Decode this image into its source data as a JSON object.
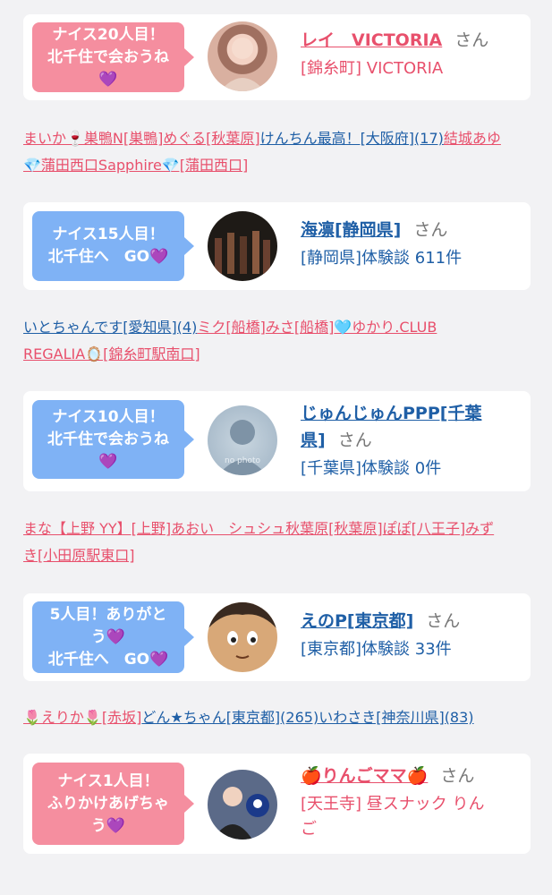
{
  "cards": [
    {
      "bubble": [
        "ナイス20人目！",
        "北千住で会おうね",
        "💜"
      ],
      "name": "レイ　VICTORIA",
      "san": "さん",
      "sub": "[錦糸町] VICTORIA"
    },
    {
      "bubble": [
        "ナイス15人目！",
        "北千住へ　GO💜"
      ],
      "name": "海凛[静岡県]",
      "san": "さん",
      "sub": "[静岡県]体験談 611件"
    },
    {
      "bubble": [
        "ナイス10人目！",
        "北千住で会おうね",
        "💜"
      ],
      "name": "じゅんじゅんPPP[千葉",
      "name2": "県]",
      "san": "さん",
      "sub": "[千葉県]体験談 0件",
      "avatar_text": "no photo"
    },
    {
      "bubble": [
        "5人目！ありがと",
        "う💜",
        "北千住へ　GO💜"
      ],
      "name": "えのP[東京都]",
      "san": "さん",
      "sub": "[東京都]体験談 33件"
    },
    {
      "bubble": [
        "ナイス1人目！",
        "ふりかけあげちゃ",
        "う💜"
      ],
      "name": "🍎りんごママ🍎",
      "san": "さん",
      "sub": "[天王寺] 昼スナック りん",
      "sub2": "ご"
    }
  ],
  "lines1": {
    "l1": [
      "まいか🍷巣鴨N[巣鴨]",
      "めぐる[秋葉原]",
      "けんちん最高！[大阪府](17)",
      "結城あゆ"
    ],
    "l2": [
      "💎蒲田西口Sapphire💎[蒲田西口]"
    ]
  },
  "lines2": {
    "l1": [
      "いとちゃんです[愛知県](4)",
      "ミク[船橋]",
      "みさ[船橋]",
      "🩵ゆかり.CLUB"
    ],
    "l2": [
      "REGALIA🪞[錦糸町駅南口]"
    ]
  },
  "lines3": {
    "l1": [
      "まな【上野 YY】[上野]",
      "あおい　シュシュ秋葉原[秋葉原]",
      "ぽぽ[八王子]",
      "みず"
    ],
    "l2": [
      "き[小田原駅東口]"
    ]
  },
  "lines4": {
    "l1": [
      "🌷えりか🌷[赤坂]",
      "どん★ちゃん[東京都](265)",
      "いわさき[神奈川県](83)"
    ]
  }
}
